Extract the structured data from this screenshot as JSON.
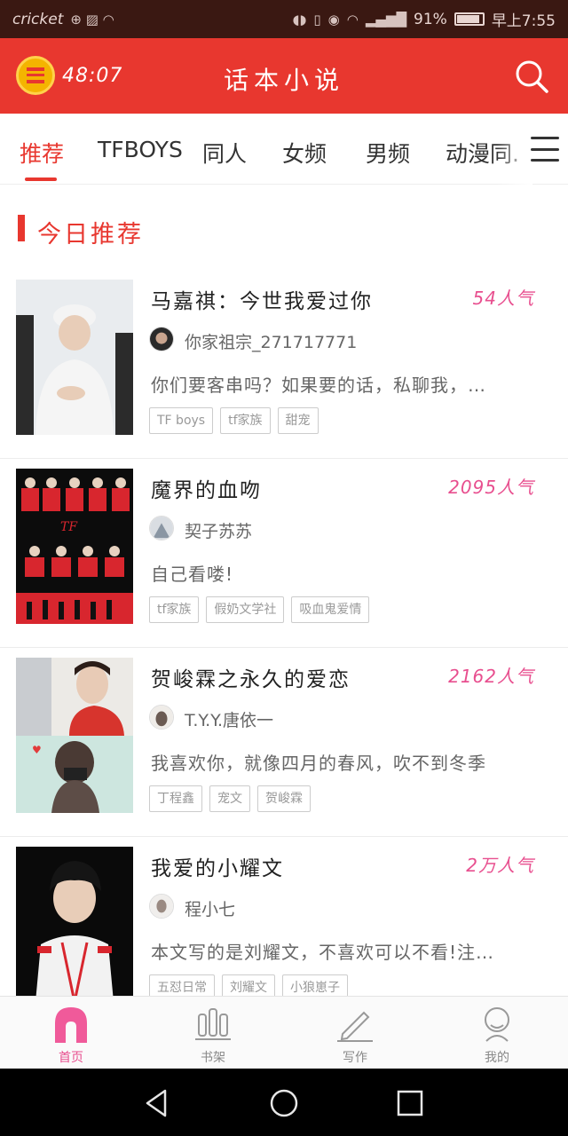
{
  "status_bar": {
    "carrier": "cricket",
    "battery_text": "91%",
    "battery_level": 0.91,
    "time": "早上7:55"
  },
  "header": {
    "timer": "48:07",
    "title": "话本小说"
  },
  "tabs": [
    {
      "label": "推荐",
      "active": true
    },
    {
      "label": "TFBOYS"
    },
    {
      "label": "同人"
    },
    {
      "label": "女频"
    },
    {
      "label": "男频"
    },
    {
      "label": "动漫同."
    }
  ],
  "section": {
    "title": "今日推荐"
  },
  "books": [
    {
      "title": "马嘉祺：今世我爱过你",
      "popularity": "54人气",
      "author": "你家祖宗_271717771",
      "description": "你们要客串吗？如果要的话，私聊我，…",
      "tags": [
        "TF boys",
        "tf家族",
        "甜宠"
      ]
    },
    {
      "title": "魔界的血吻",
      "popularity": "2095人气",
      "author": "契子苏苏",
      "description": "自己看喽!",
      "tags": [
        "tf家族",
        "假奶文学社",
        "吸血鬼爱情"
      ]
    },
    {
      "title": "贺峻霖之永久的爱恋",
      "popularity": "2162人气",
      "author": "T.Y.Y.唐依一",
      "description": "我喜欢你，就像四月的春风，吹不到冬季",
      "tags": [
        "丁程鑫",
        "宠文",
        "贺峻霖"
      ]
    },
    {
      "title": "我爱的小耀文",
      "popularity": "2万人气",
      "author": "程小七",
      "description": "本文写的是刘耀文，不喜欢可以不看!注…",
      "tags": [
        "五怼日常",
        "刘耀文",
        "小狼崽子"
      ]
    }
  ],
  "bottom_nav": [
    {
      "label": "首页",
      "active": true
    },
    {
      "label": "书架"
    },
    {
      "label": "写作"
    },
    {
      "label": "我的"
    }
  ],
  "colors": {
    "brand_red": "#e8372f",
    "popularity_pink": "#e84f8f",
    "status_bar_bg": "#3a1812"
  }
}
